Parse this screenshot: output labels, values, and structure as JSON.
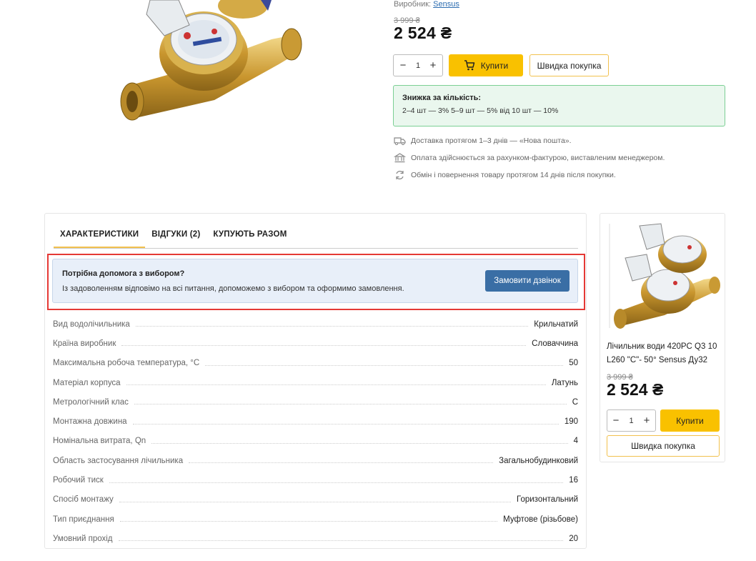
{
  "product": {
    "maker_label": "Виробник:",
    "maker_name": "Sensus",
    "old_price": "3 999 ₴",
    "price": "2 524 ₴",
    "qty": "1",
    "buy_label": "Купити",
    "quick_buy_label": "Швидка покупка"
  },
  "discount": {
    "title": "Знижка за кількість:",
    "details": "2–4 шт — 3% 5–9 шт — 5% від 10 шт — 10%"
  },
  "info": {
    "delivery": "Доставка протягом 1–3 днів — «Нова пошта».",
    "payment": "Оплата здійснюється за рахунком-фактурою, виставленим менеджером.",
    "returns": "Обмін і повернення товару протягом 14 днів після покупки."
  },
  "tabs": [
    {
      "label": "ХАРАКТЕРИСТИКИ",
      "active": true
    },
    {
      "label": "ВІДГУКИ (2)",
      "active": false
    },
    {
      "label": "КУПУЮТЬ РАЗОМ",
      "active": false
    }
  ],
  "help": {
    "title": "Потрібна допомога з вибором?",
    "text": "Із задоволенням відповімо на всі питання, допоможемо з вибором та оформимо замовлення.",
    "button": "Замовити дзвінок"
  },
  "specs": [
    {
      "key": "Вид водолічильника",
      "value": "Крильчатий"
    },
    {
      "key": "Країна виробник",
      "value": "Словаччина"
    },
    {
      "key": "Максимальна робоча температура, °C",
      "value": "50"
    },
    {
      "key": "Матеріал корпуса",
      "value": "Латунь"
    },
    {
      "key": "Метрологічний клас",
      "value": "C"
    },
    {
      "key": "Монтажна довжина",
      "value": "190"
    },
    {
      "key": "Номінальна витрата, Qn",
      "value": "4"
    },
    {
      "key": "Область застосування лічильника",
      "value": "Загальнобудинковий"
    },
    {
      "key": "Робочий тиск",
      "value": "16"
    },
    {
      "key": "Спосіб монтажу",
      "value": "Горизонтальний"
    },
    {
      "key": "Тип приєднання",
      "value": "Муфтове (різьбове)"
    },
    {
      "key": "Умовний прохід",
      "value": "20"
    }
  ],
  "side_card": {
    "name": "Лічильник води 420PC Q3 10 L260 \"C\"- 50° Sensus Ду32",
    "old_price": "3 999 ₴",
    "price": "2 524 ₴",
    "qty": "1",
    "buy_label": "Купити",
    "quick_buy_label": "Швидка покупка"
  },
  "colors": {
    "accent": "#f9c100",
    "button_blue": "#3a6ea5",
    "discount_bg": "#eaf7ee",
    "highlight_red": "#e53935"
  }
}
